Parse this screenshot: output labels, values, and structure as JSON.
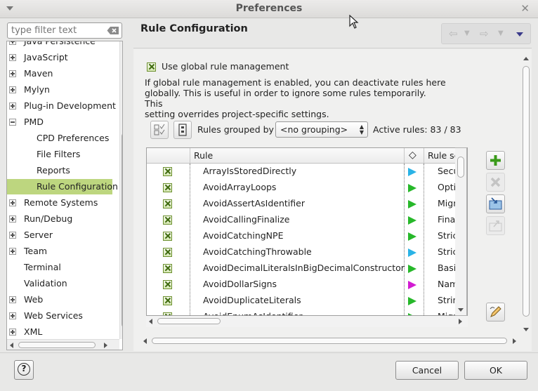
{
  "window": {
    "title": "Preferences"
  },
  "filter": {
    "placeholder": "type filter text"
  },
  "tree": {
    "items": [
      {
        "label": "Java Persistence",
        "expander": "plus",
        "level": 0,
        "selected": false
      },
      {
        "label": "JavaScript",
        "expander": "plus",
        "level": 0,
        "selected": false
      },
      {
        "label": "Maven",
        "expander": "plus",
        "level": 0,
        "selected": false
      },
      {
        "label": "Mylyn",
        "expander": "plus",
        "level": 0,
        "selected": false
      },
      {
        "label": "Plug-in Development",
        "expander": "plus",
        "level": 0,
        "selected": false
      },
      {
        "label": "PMD",
        "expander": "minus",
        "level": 0,
        "selected": false
      },
      {
        "label": "CPD Preferences",
        "expander": "none",
        "level": 1,
        "selected": false
      },
      {
        "label": "File Filters",
        "expander": "none",
        "level": 1,
        "selected": false
      },
      {
        "label": "Reports",
        "expander": "none",
        "level": 1,
        "selected": false
      },
      {
        "label": "Rule Configuration",
        "expander": "none",
        "level": 1,
        "selected": true
      },
      {
        "label": "Remote Systems",
        "expander": "plus",
        "level": 0,
        "selected": false
      },
      {
        "label": "Run/Debug",
        "expander": "plus",
        "level": 0,
        "selected": false
      },
      {
        "label": "Server",
        "expander": "plus",
        "level": 0,
        "selected": false
      },
      {
        "label": "Team",
        "expander": "plus",
        "level": 0,
        "selected": false
      },
      {
        "label": "Terminal",
        "expander": "none",
        "level": 0,
        "selected": false
      },
      {
        "label": "Validation",
        "expander": "none",
        "level": 0,
        "selected": false
      },
      {
        "label": "Web",
        "expander": "plus",
        "level": 0,
        "selected": false
      },
      {
        "label": "Web Services",
        "expander": "plus",
        "level": 0,
        "selected": false
      },
      {
        "label": "XML",
        "expander": "plus",
        "level": 0,
        "selected": false
      }
    ]
  },
  "page": {
    "title": "Rule Configuration",
    "global_checkbox_label": "Use global rule management",
    "global_checked": true,
    "description_lines": [
      "If global rule management is enabled, you can deactivate rules here",
      "globally. This is useful in order to ignore some rules temporarily. This",
      "setting overrides project-specific settings."
    ],
    "grouped_label": "Rules grouped by",
    "grouping_value": "<no grouping>",
    "active_rules": "Active rules: 83 / 83"
  },
  "table": {
    "columns": {
      "rule": "Rule",
      "priority_symbol": "◇",
      "ruleset": "Rule set"
    },
    "rows": [
      {
        "name": "ArrayIsStoredDirectly",
        "set": "Security",
        "color": "#2ab3e6"
      },
      {
        "name": "AvoidArrayLoops",
        "set": "Optimization",
        "color": "#27b82a"
      },
      {
        "name": "AvoidAssertAsIdentifier",
        "set": "Migration",
        "color": "#27b82a"
      },
      {
        "name": "AvoidCallingFinalize",
        "set": "Finalizer",
        "color": "#27b82a"
      },
      {
        "name": "AvoidCatchingNPE",
        "set": "Strict Exceptions",
        "color": "#27b82a"
      },
      {
        "name": "AvoidCatchingThrowable",
        "set": "Strict Exceptions",
        "color": "#2ab3e6"
      },
      {
        "name": "AvoidDecimalLiteralsInBigDecimalConstructor",
        "set": "Basic",
        "color": "#27b82a"
      },
      {
        "name": "AvoidDollarSigns",
        "set": "Naming",
        "color": "#d21bd2"
      },
      {
        "name": "AvoidDuplicateLiterals",
        "set": "String and StringBuffer",
        "color": "#27b82a"
      },
      {
        "name": "AvoidEnumAsIdentifier",
        "set": "Migration",
        "color": "#27b82a"
      }
    ]
  },
  "buttons": {
    "cancel": "Cancel",
    "ok": "OK",
    "help": "?"
  }
}
